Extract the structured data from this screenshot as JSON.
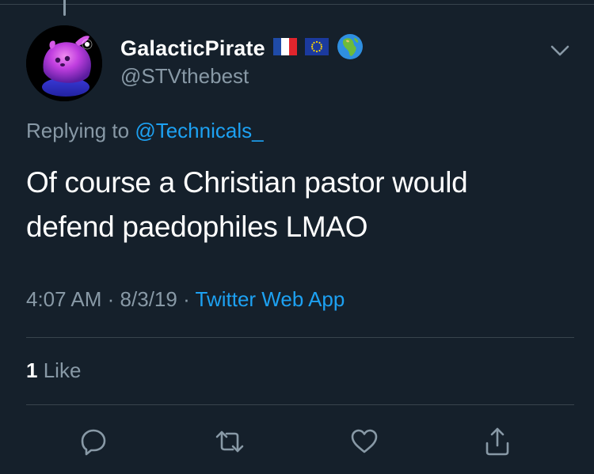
{
  "tweet": {
    "author": {
      "display_name": "GalacticPirate",
      "handle": "@STVthebest",
      "badges": [
        "flag-france-icon",
        "flag-eu-icon",
        "globe-africa-icon"
      ]
    },
    "replying_prefix": "Replying to",
    "replying_to": "@Technicals_",
    "text_line1": "Of course a Christian pastor would",
    "text_line2": "defend paedophiles LMAO",
    "time": "4:07 AM",
    "date": "8/3/19",
    "separator": "·",
    "source": "Twitter Web App",
    "like_count": "1",
    "like_label": "Like"
  },
  "actions": [
    "reply-icon",
    "retweet-icon",
    "like-icon",
    "share-icon"
  ],
  "colors": {
    "background": "#15202b",
    "text": "#ffffff",
    "secondary": "#8899a6",
    "accent": "#1da1f2",
    "divider": "#38444d"
  }
}
